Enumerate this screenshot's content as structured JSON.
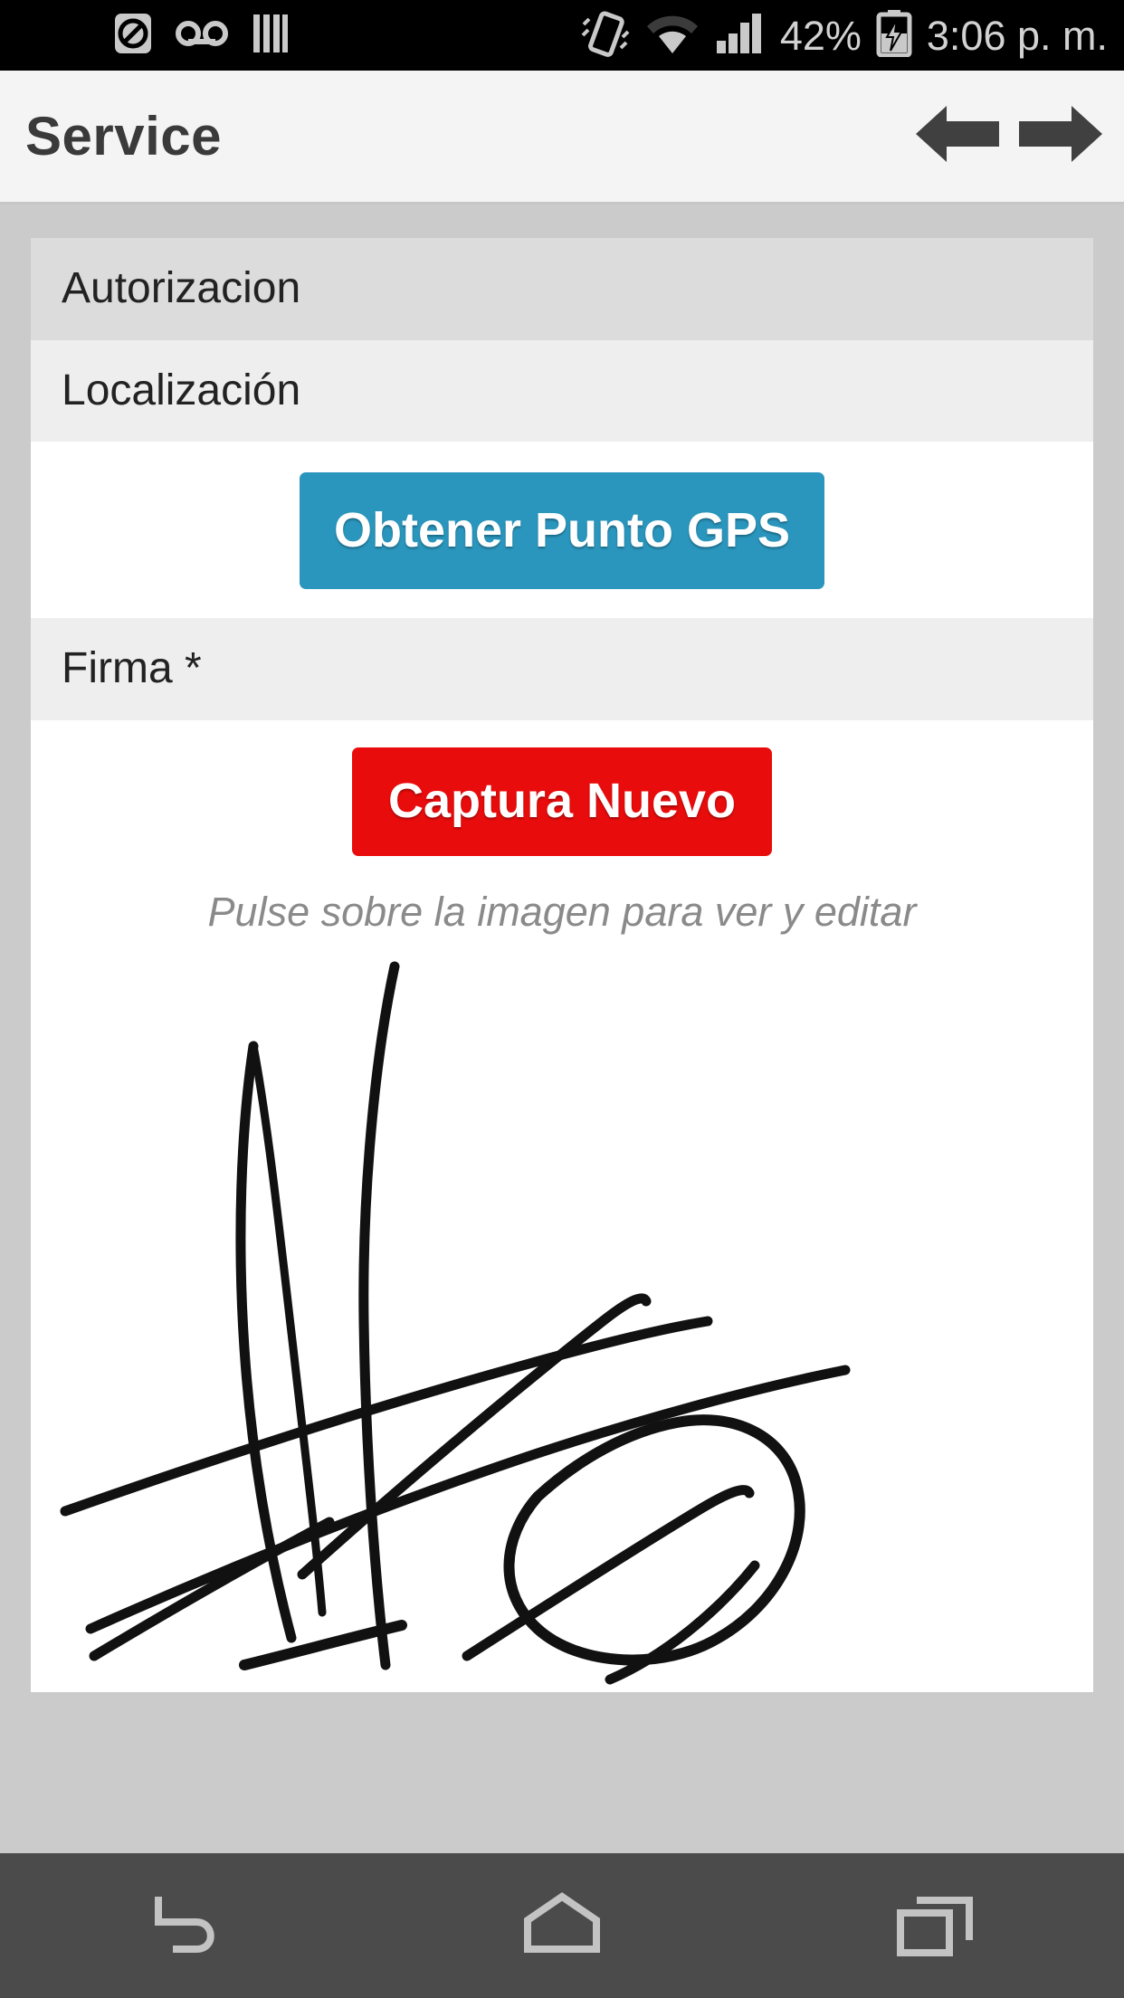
{
  "statusbar": {
    "icons_left": [
      "do-not-disturb-icon",
      "voicemail-icon",
      "equalizer-icon"
    ],
    "icons_right": [
      "vibrate-icon",
      "wifi-icon",
      "cell-signal-icon"
    ],
    "battery_percent": "42%",
    "battery_state": "charging",
    "time": "3:06 p. m."
  },
  "header": {
    "title": "Service",
    "back_label": "back-arrow",
    "forward_label": "forward-arrow"
  },
  "form": {
    "rows": [
      {
        "label": "Autorizacion",
        "style": "dark"
      },
      {
        "label": "Localización",
        "style": "light"
      }
    ],
    "gps_button": "Obtener Punto GPS",
    "signature_label": "Firma *",
    "capture_button": "Captura Nuevo",
    "signature_hint": "Pulse sobre la imagen para ver y editar"
  },
  "colors": {
    "gps_button": "#2a96bd",
    "capture_button": "#e90c0c",
    "page_background": "#cbcbcb",
    "header_background": "#f4f4f4",
    "row_dark": "#dcdcdc",
    "row_light": "#eeeeee",
    "navbar": "#4b4b4b"
  },
  "sysnav": {
    "back": "back-nav",
    "home": "home-nav",
    "recents": "recents-nav"
  }
}
